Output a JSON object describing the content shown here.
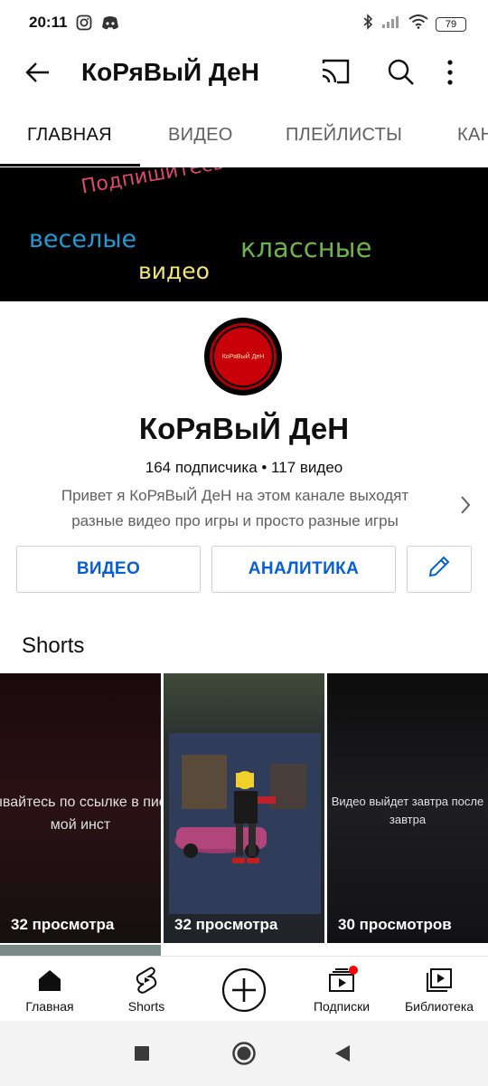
{
  "status_bar": {
    "time": "20:11",
    "battery": "79",
    "icons": [
      "instagram-icon",
      "discord-icon",
      "bluetooth-icon",
      "signal-icon",
      "wifi-icon",
      "battery-icon"
    ]
  },
  "top_bar": {
    "title": "КоРяВыЙ ДеН",
    "icons": [
      "back-arrow-icon",
      "cast-icon",
      "search-icon",
      "more-vert-icon"
    ]
  },
  "tabs": [
    {
      "label": "ГЛАВНАЯ",
      "active": true
    },
    {
      "label": "ВИДЕО",
      "active": false
    },
    {
      "label": "ПЛЕЙЛИСТЫ",
      "active": false
    },
    {
      "label": "КАН",
      "active": false
    }
  ],
  "banner": {
    "top_text": "Подпишитесь на канал",
    "fun": "веселые",
    "cool": "классные",
    "videos": "видео"
  },
  "channel": {
    "avatar_text": "КоРяВыЙ ДеН",
    "name": "КоРяВыЙ ДеН",
    "stats": "164 подписчика • 117 видео",
    "description_line1": "Привет я КоРяВыЙ ДеН на этом канале выходят",
    "description_line2": "разные видео про игры и просто разные игры"
  },
  "actions": {
    "video": "ВИДЕО",
    "analytics": "АНАЛИТИКА",
    "edit_icon": "pencil-icon"
  },
  "shorts": {
    "title": "Shorts",
    "items": [
      {
        "caption": "Подписывайтесь по ссылке в писании на мой инст",
        "views": "32 просмотра"
      },
      {
        "caption": "",
        "views": "32 просмотра"
      },
      {
        "caption": "Видео выйдет завтра после завтра",
        "views": "30 просмотров"
      }
    ]
  },
  "bottom_nav": [
    {
      "label": "Главная",
      "icon": "home-icon"
    },
    {
      "label": "Shorts",
      "icon": "shorts-icon"
    },
    {
      "label": "",
      "icon": "create-plus-icon"
    },
    {
      "label": "Подписки",
      "icon": "subscriptions-icon"
    },
    {
      "label": "Библиотека",
      "icon": "library-icon"
    }
  ],
  "colors": {
    "accent_blue": "#065fd4",
    "notification_red": "#ff0000",
    "banner_bg": "#000000"
  }
}
